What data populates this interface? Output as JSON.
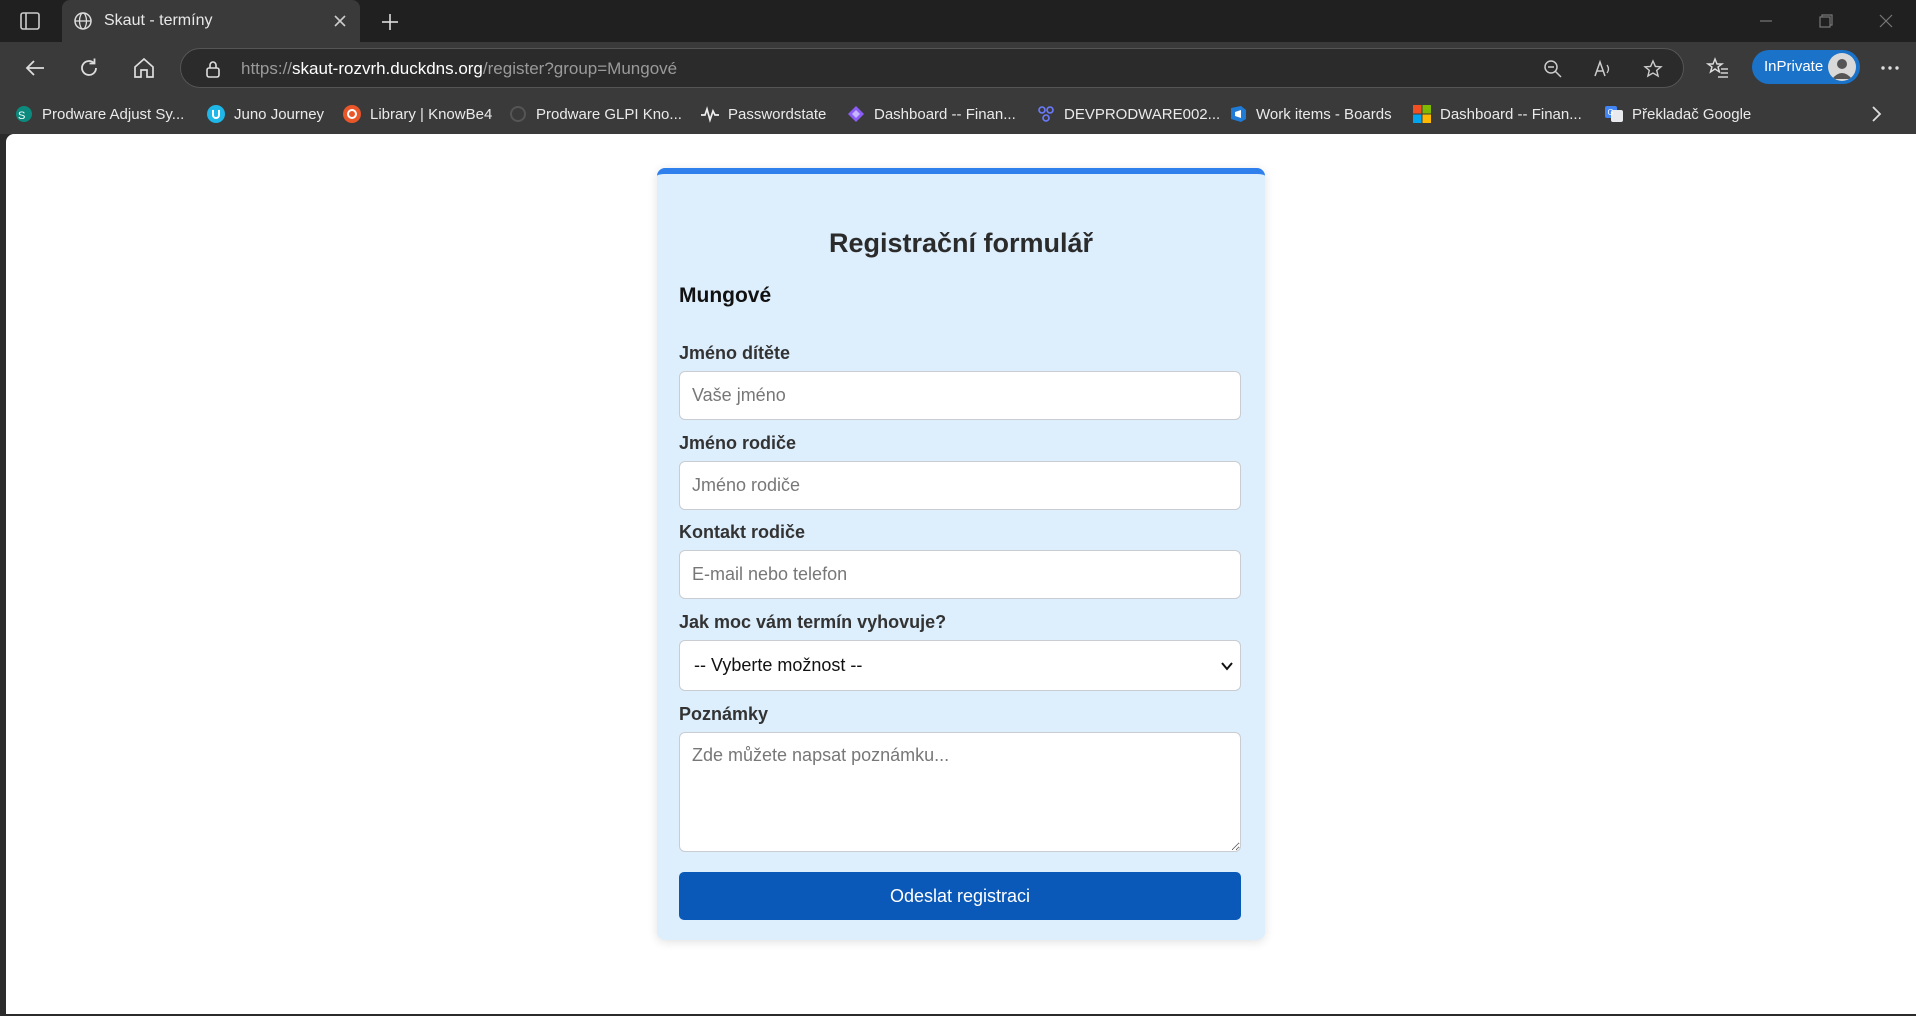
{
  "browser": {
    "tab_title": "Skaut - termíny",
    "url_scheme": "https://",
    "url_host": "skaut-rozvrh.duckdns.org",
    "url_path": "/register?group=Mungové",
    "inprivate_label": "InPrivate",
    "accent": "#1a73c9"
  },
  "bookmarks": [
    {
      "label": "Prodware Adjust Sy...",
      "icon": "sharepoint-icon"
    },
    {
      "label": "Juno Journey",
      "icon": "juno-icon"
    },
    {
      "label": "Library | KnowBe4",
      "icon": "knowbe4-icon"
    },
    {
      "label": "Prodware GLPI Kno...",
      "icon": "glpi-icon"
    },
    {
      "label": "Passwordstate",
      "icon": "pulse-icon"
    },
    {
      "label": "Dashboard -- Finan...",
      "icon": "dashboard-icon"
    },
    {
      "label": "DEVPRODWARE002...",
      "icon": "devops-icon"
    },
    {
      "label": "Work items - Boards",
      "icon": "boards-icon"
    },
    {
      "label": "Dashboard -- Finan...",
      "icon": "microsoft-icon"
    },
    {
      "label": "Překladač Google",
      "icon": "translate-icon"
    }
  ],
  "form": {
    "title": "Registrační formulář",
    "group": "Mungové",
    "child_name_label": "Jméno dítěte",
    "child_name_placeholder": "Vaše jméno",
    "parent_name_label": "Jméno rodiče",
    "parent_name_placeholder": "Jméno rodiče",
    "contact_label": "Kontakt rodiče",
    "contact_placeholder": "E-mail nebo telefon",
    "suitability_label": "Jak moc vám termín vyhovuje?",
    "suitability_selected": "-- Vyberte možnost --",
    "notes_label": "Poznámky",
    "notes_placeholder": "Zde můžete napsat poznámku...",
    "submit_label": "Odeslat registraci",
    "card_color": "#ddeefc",
    "border_accent": "#2f80ed",
    "button_color": "#0a58b8"
  }
}
